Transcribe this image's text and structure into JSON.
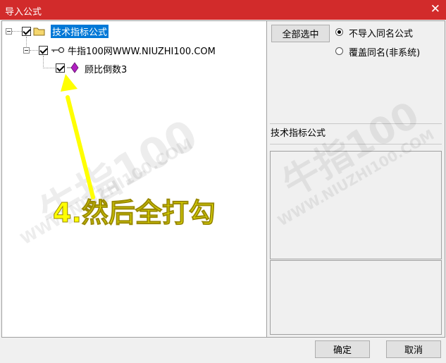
{
  "window": {
    "title": "导入公式",
    "close_glyph": "✕"
  },
  "tree": {
    "root": {
      "label": "技术指标公式",
      "checked": true,
      "icon": "folder-icon"
    },
    "group": {
      "label": "牛指100网WWW.NIUZHI100.COM",
      "checked": true,
      "icon": "key-icon"
    },
    "item": {
      "label": "顾比倒数3",
      "checked": true,
      "icon": "diamond-icon"
    }
  },
  "options": {
    "select_all_label": "全部选中",
    "radio_no_import": "不导入同名公式",
    "radio_overwrite": "覆盖同名(非系统)",
    "selected": "radio_no_import"
  },
  "info": {
    "category_label": "技术指标公式"
  },
  "buttons": {
    "ok": "确定",
    "cancel": "取消"
  },
  "annotation": {
    "text": "4.然后全打勾",
    "color": "#ffff00"
  },
  "watermark": {
    "text1": "牛指100",
    "text2": "WWW.NIUZHI100.COM"
  }
}
